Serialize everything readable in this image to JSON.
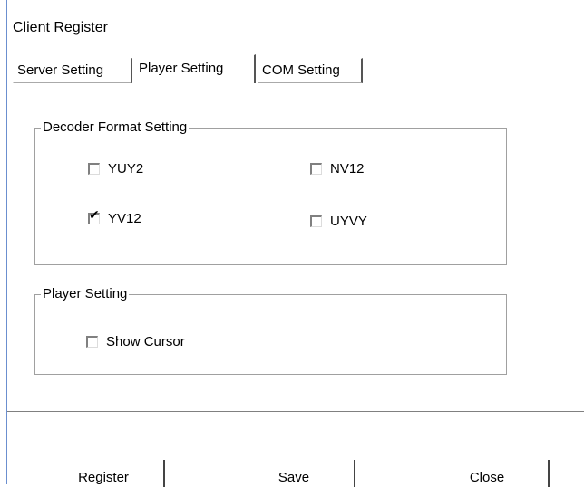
{
  "window": {
    "title": "Client Register"
  },
  "tabs": [
    {
      "label": "Server Setting",
      "active": false
    },
    {
      "label": "Player Setting",
      "active": true
    },
    {
      "label": "COM Setting",
      "active": false
    }
  ],
  "decoder_group": {
    "label": "Decoder Format Setting",
    "options": [
      {
        "label": "YUY2",
        "checked": false
      },
      {
        "label": "NV12",
        "checked": false
      },
      {
        "label": "YV12",
        "checked": true
      },
      {
        "label": "UYVY",
        "checked": false
      }
    ]
  },
  "player_group": {
    "label": "Player Setting",
    "options": [
      {
        "label": "Show Cursor",
        "checked": false
      }
    ]
  },
  "buttons": {
    "register": "Register",
    "save": "Save",
    "close": "Close"
  },
  "colors": {
    "accent_border": "#6b8fcf",
    "group_border": "#a0a0a0"
  },
  "icons": {
    "check": "✔"
  }
}
